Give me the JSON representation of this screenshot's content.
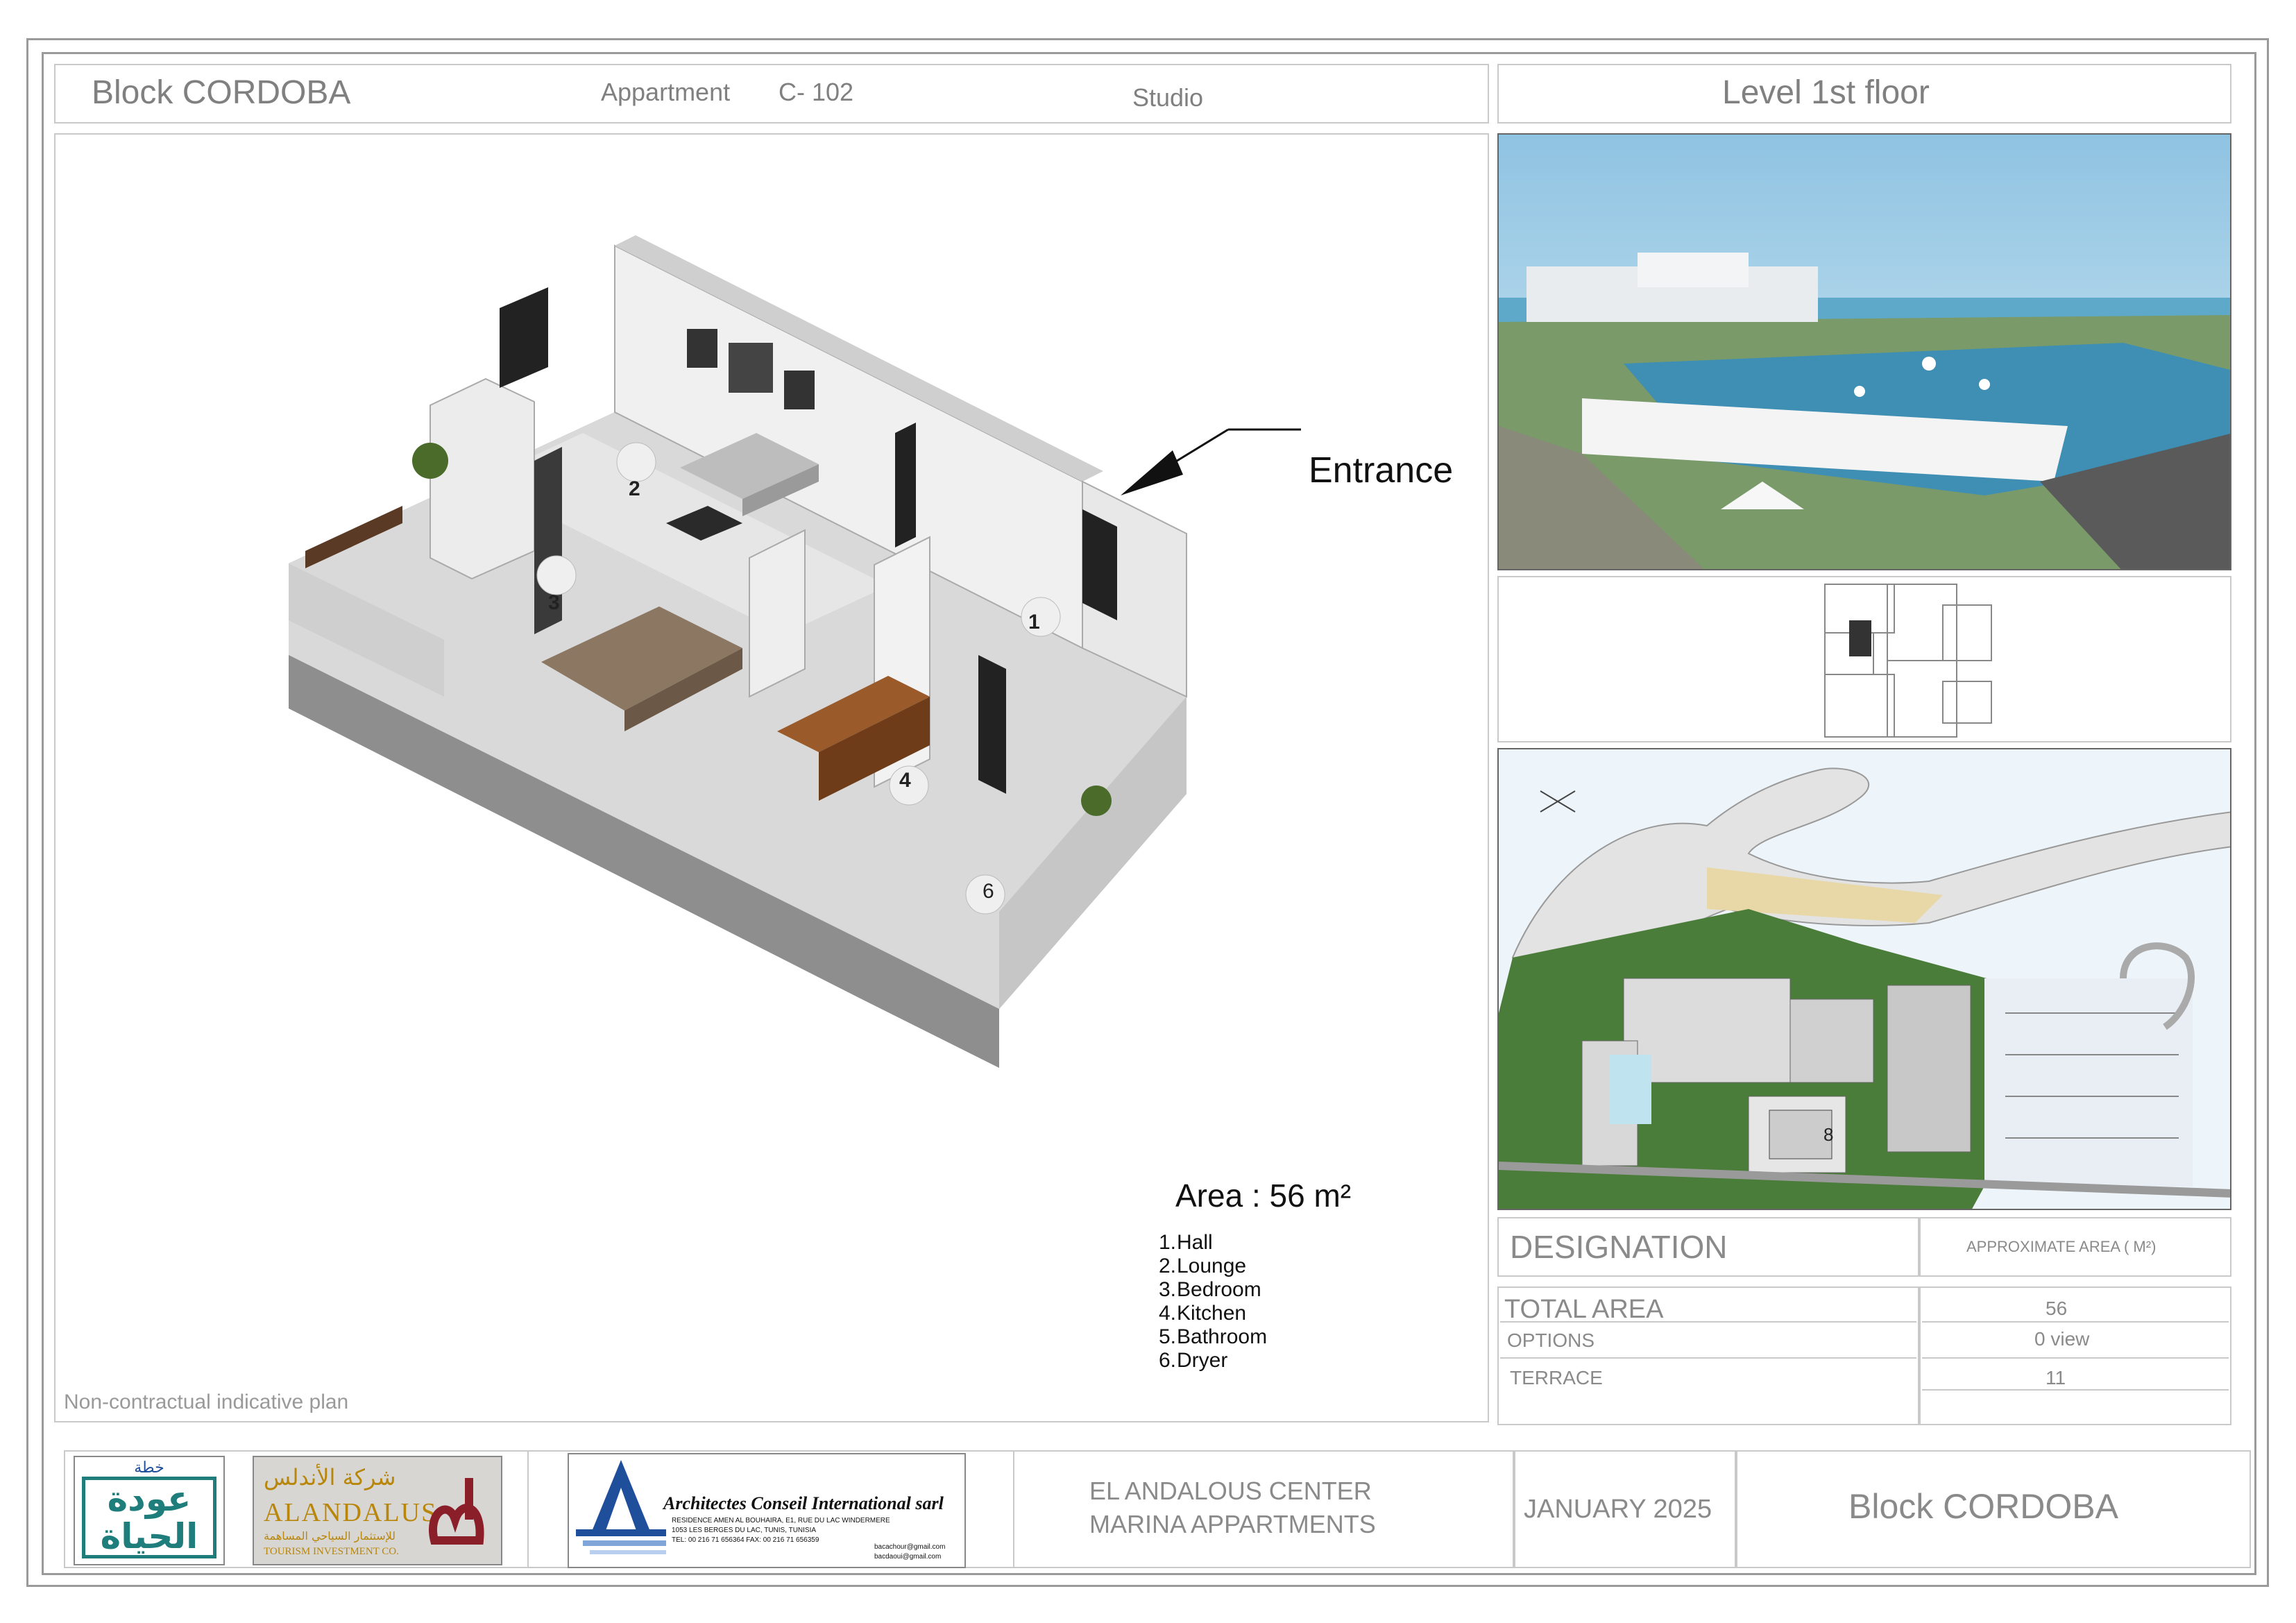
{
  "header": {
    "block": "Block CORDOBA",
    "apartment_label": "Appartment",
    "apartment_code": "C- 102",
    "type": "Studio",
    "level": "Level 1st floor"
  },
  "plan": {
    "entrance_label": "Entrance",
    "rooms": [
      "1",
      "2",
      "3",
      "4",
      "6"
    ],
    "disclaimer": "Non-contractual indicative plan",
    "area_title": "Area : 56 m²",
    "legend": [
      {
        "num": "1.",
        "name": "Hall"
      },
      {
        "num": "2.",
        "name": "Lounge"
      },
      {
        "num": "3.",
        "name": "Bedroom"
      },
      {
        "num": "4.",
        "name": "Kitchen"
      },
      {
        "num": "5.",
        "name": "Bathroom"
      },
      {
        "num": "6.",
        "name": "Dryer"
      }
    ]
  },
  "site_plan": {
    "building_label": "8"
  },
  "table": {
    "designation": "DESIGNATION",
    "approx_area": "APPROXIMATE AREA  ( M²)",
    "rows": [
      {
        "label": "TOTAL AREA",
        "value": "56"
      },
      {
        "label": "OPTIONS",
        "value": "0 view"
      },
      {
        "label": "TERRACE",
        "value": "11"
      }
    ]
  },
  "footer": {
    "logo1_top": "خطة",
    "logo1_main": "عودة الحياة",
    "logo2_arabic": "شركة الأندلس",
    "logo2_name": "ALANDALUS",
    "logo2_arabic_sub": "للإستثمار السياحي المساهمة",
    "logo2_sub": "TOURISM INVESTMENT CO.",
    "logo3_name": "Architectes  Conseil  International sarl",
    "logo3_addr1": "RESIDENCE  AMEN AL BOUHAIRA, E1, RUE DU LAC WINDERMERE",
    "logo3_addr2": "1053 LES BERGES DU LAC, TUNIS, TUNISIA",
    "logo3_tel": "TEL: 00 216 71 656364   FAX: 00 216 71 656359",
    "logo3_mail1": "bacachour@gmail.com",
    "logo3_mail2": "bacdaoui@gmail.com",
    "project_line1": "EL ANDALOUS CENTER",
    "project_line2": "MARINA APPARTMENTS",
    "date": "JANUARY  2025",
    "block": "Block  CORDOBA"
  },
  "colors": {
    "frame": "#9a9a9a",
    "sea": "#3f8fb4",
    "sky": "#bfdff0",
    "wood": "#9a5a2a",
    "logo_green": "#1f7d7b",
    "logo_blue": "#1f4f9a",
    "logo_red": "#8a1f2a"
  }
}
